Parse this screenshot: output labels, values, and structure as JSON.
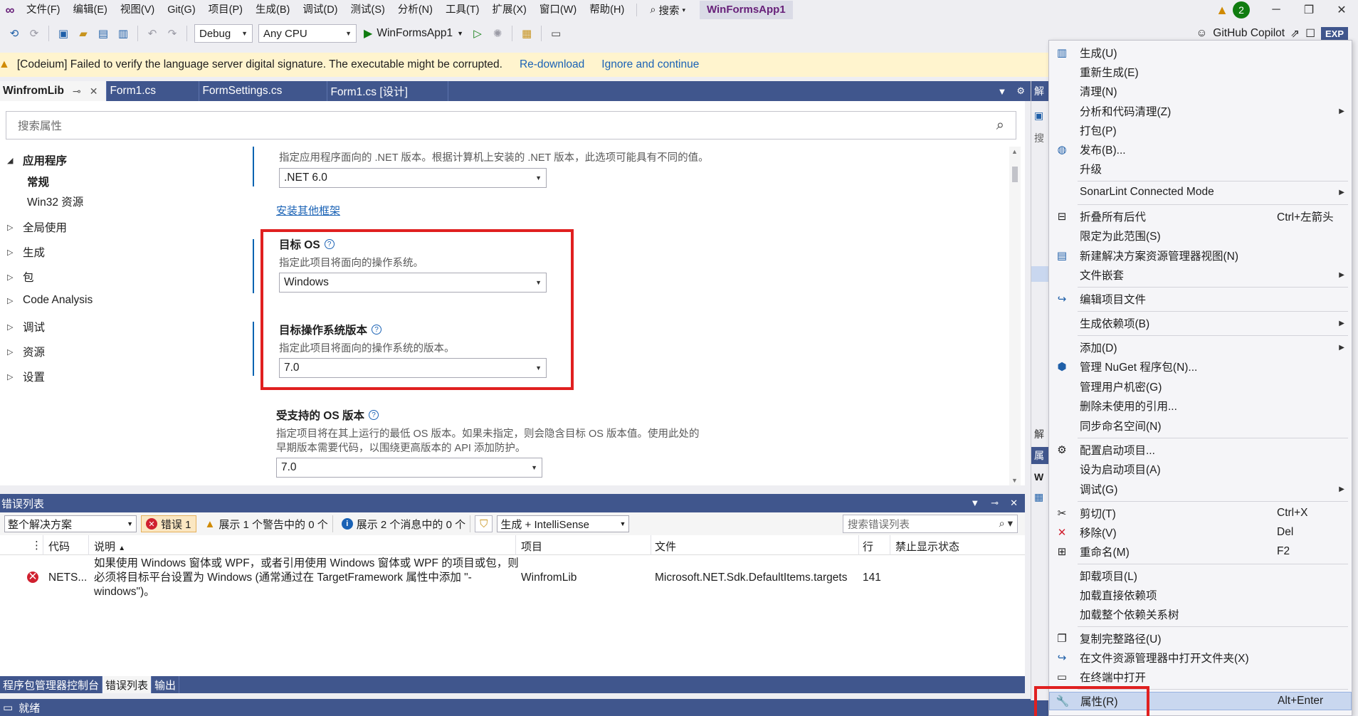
{
  "menubar": {
    "items": [
      "文件(F)",
      "编辑(E)",
      "视图(V)",
      "Git(G)",
      "项目(P)",
      "生成(B)",
      "调试(D)",
      "测试(S)",
      "分析(N)",
      "工具(T)",
      "扩展(X)",
      "窗口(W)",
      "帮助(H)"
    ],
    "search_label": "搜索",
    "window_title": "WinFormsApp1",
    "notification_count": "2"
  },
  "toolbar": {
    "config": "Debug",
    "platform": "Any CPU",
    "run_target": "WinFormsApp1",
    "copilot_label": "GitHub Copilot",
    "exp_label": "EXP"
  },
  "infobar": {
    "message": "[Codeium] Failed to verify the language server digital signature. The executable might be corrupted.",
    "link1": "Re-download",
    "link2": "Ignore and continue"
  },
  "doc_tabs": [
    {
      "label": "WinfromLib",
      "active": true
    },
    {
      "label": "Form1.cs",
      "active": false
    },
    {
      "label": "FormSettings.cs",
      "active": false
    },
    {
      "label": "Form1.cs [设计]",
      "active": false
    }
  ],
  "props": {
    "search_placeholder": "搜索属性",
    "tree": {
      "app": "应用程序",
      "app_children": [
        "常规",
        "Win32 资源"
      ],
      "others": [
        "全局使用",
        "生成",
        "包",
        "Code Analysis",
        "调试",
        "资源",
        "设置"
      ]
    },
    "framework_desc": "指定应用程序面向的 .NET 版本。根据计算机上安装的 .NET 版本，此选项可能具有不同的值。",
    "framework_value": ".NET 6.0",
    "install_link": "安装其他框架",
    "target_os_title": "目标 OS",
    "target_os_desc": "指定此项目将面向的操作系统。",
    "target_os_value": "Windows",
    "target_os_ver_title": "目标操作系统版本",
    "target_os_ver_desc": "指定此项目将面向的操作系统的版本。",
    "target_os_ver_value": "7.0",
    "supported_os_title": "受支持的 OS 版本",
    "supported_os_desc1": "指定项目将在其上运行的最低 OS 版本。如果未指定，则会隐含目标 OS 版本值。使用此处的",
    "supported_os_desc2": "早期版本需要代码，以围绕更高版本的 API 添加防护。",
    "supported_os_value": "7.0"
  },
  "error_list": {
    "title": "错误列表",
    "scope": "整个解决方案",
    "errors_label": "错误 1",
    "warnings_label": "展示 1 个警告中的 0 个",
    "messages_label": "展示 2 个消息中的 0 个",
    "build_filter": "生成 + IntelliSense",
    "search_placeholder": "搜索错误列表",
    "columns": [
      "代码",
      "说明",
      "项目",
      "文件",
      "行",
      "禁止显示状态"
    ],
    "rows": [
      {
        "code": "NETS...",
        "desc1": "如果使用 Windows 窗体或 WPF，或者引用使用 Windows 窗体或 WPF 的项目或包，则",
        "desc2": "必须将目标平台设置为 Windows (通常通过在 TargetFramework 属性中添加 \"-",
        "desc3": "windows\")。",
        "project": "WinfromLib",
        "file": "Microsoft.NET.Sdk.DefaultItems.targets",
        "line": "141"
      }
    ]
  },
  "bottom_tabs": [
    "程序包管理器控制台",
    "错误列表",
    "输出"
  ],
  "status": {
    "text": "就绪"
  },
  "right_panel": {
    "top_label": "解",
    "mid_label": "解",
    "prop_label": "属",
    "w_label": "W",
    "search_label": "搜"
  },
  "context_menu": {
    "items": [
      {
        "label": "生成(U)",
        "icon": "build-icon"
      },
      {
        "label": "重新生成(E)"
      },
      {
        "label": "清理(N)"
      },
      {
        "label": "分析和代码清理(Z)",
        "submenu": true
      },
      {
        "label": "打包(P)"
      },
      {
        "label": "发布(B)...",
        "icon": "globe-icon"
      },
      {
        "label": "升级"
      },
      {
        "label": "SonarLint Connected Mode",
        "submenu": true
      },
      {
        "label": "折叠所有后代",
        "shortcut": "Ctrl+左箭头",
        "icon": "collapse-icon"
      },
      {
        "label": "限定为此范围(S)"
      },
      {
        "label": "新建解决方案资源管理器视图(N)",
        "icon": "new-view-icon"
      },
      {
        "label": "文件嵌套",
        "submenu": true
      },
      {
        "label": "编辑项目文件",
        "icon": "edit-icon"
      },
      {
        "label": "生成依赖项(B)",
        "submenu": true
      },
      {
        "label": "添加(D)",
        "submenu": true
      },
      {
        "label": "管理 NuGet 程序包(N)...",
        "icon": "nuget-icon"
      },
      {
        "label": "管理用户机密(G)"
      },
      {
        "label": "删除未使用的引用..."
      },
      {
        "label": "同步命名空间(N)"
      },
      {
        "label": "配置启动项目...",
        "icon": "gear-icon"
      },
      {
        "label": "设为启动项目(A)"
      },
      {
        "label": "调试(G)",
        "submenu": true
      },
      {
        "label": "剪切(T)",
        "shortcut": "Ctrl+X",
        "icon": "scissors-icon"
      },
      {
        "label": "移除(V)",
        "shortcut": "Del",
        "icon": "remove-icon"
      },
      {
        "label": "重命名(M)",
        "shortcut": "F2",
        "icon": "rename-icon"
      },
      {
        "label": "卸载项目(L)"
      },
      {
        "label": "加载直接依赖项"
      },
      {
        "label": "加载整个依赖关系树"
      },
      {
        "label": "复制完整路径(U)",
        "icon": "copy-icon"
      },
      {
        "label": "在文件资源管理器中打开文件夹(X)",
        "icon": "open-folder-icon"
      },
      {
        "label": "在终端中打开",
        "icon": "terminal-icon"
      },
      {
        "label": "属性(R)",
        "shortcut": "Alt+Enter",
        "icon": "wrench-icon",
        "highlighted": true
      }
    ]
  },
  "colors": {
    "accent": "#40568d",
    "highlight_red": "#e02020",
    "link": "#1a62b5",
    "infobar": "#fff4ce"
  }
}
